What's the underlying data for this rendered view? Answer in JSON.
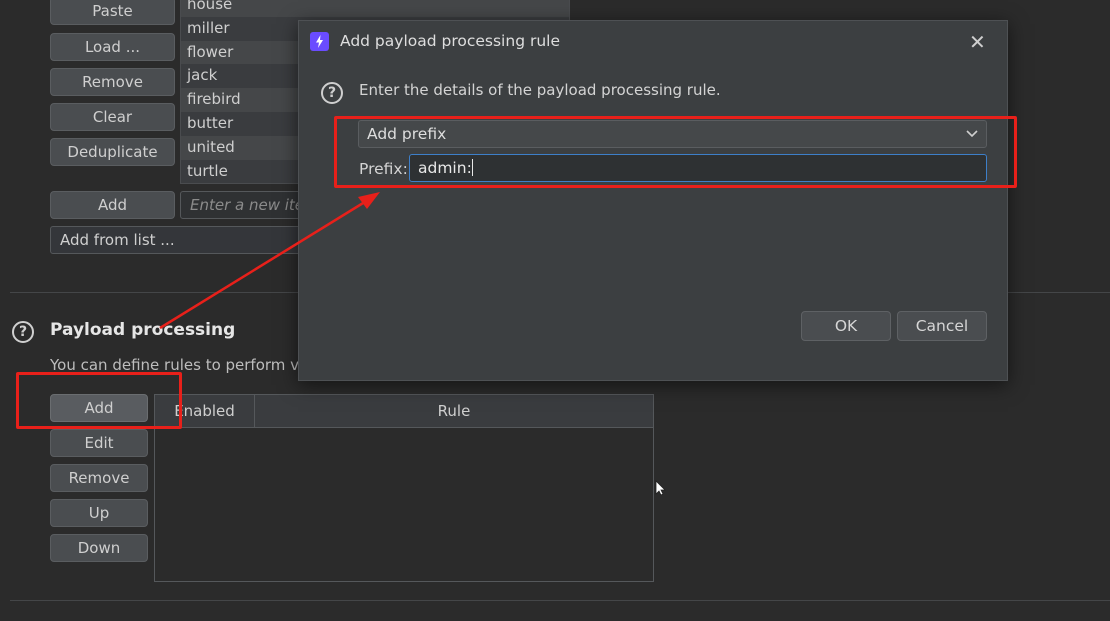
{
  "wordlist": {
    "buttons": [
      "Paste",
      "Load ...",
      "Remove",
      "Clear",
      "Deduplicate"
    ],
    "items": [
      "house",
      "miller",
      "flower",
      "jack",
      "firebird",
      "butter",
      "united",
      "turtle"
    ],
    "add_button": "Add",
    "new_item_placeholder": "Enter a new ite",
    "add_from_list": "Add from list ..."
  },
  "payload_processing": {
    "help": "?",
    "title": "Payload processing",
    "description": "You can define rules to perform va",
    "buttons": [
      "Add",
      "Edit",
      "Remove",
      "Up",
      "Down"
    ],
    "table_headers": [
      "Enabled",
      "Rule"
    ]
  },
  "dialog": {
    "title": "Add payload processing rule",
    "help": "?",
    "description": "Enter the details of the payload processing rule.",
    "rule_type": "Add prefix",
    "prefix_label": "Prefix:",
    "prefix_value": "admin:",
    "ok": "OK",
    "cancel": "Cancel"
  },
  "colors": {
    "highlight": "#e8201a",
    "background": "#2b2b2b",
    "dialog_background": "#3c3f41",
    "accent_logo": "#6a4cff"
  },
  "icons": [
    "lightning-icon",
    "close-icon",
    "help-icon",
    "chevron-down-icon",
    "mouse-cursor-icon"
  ]
}
